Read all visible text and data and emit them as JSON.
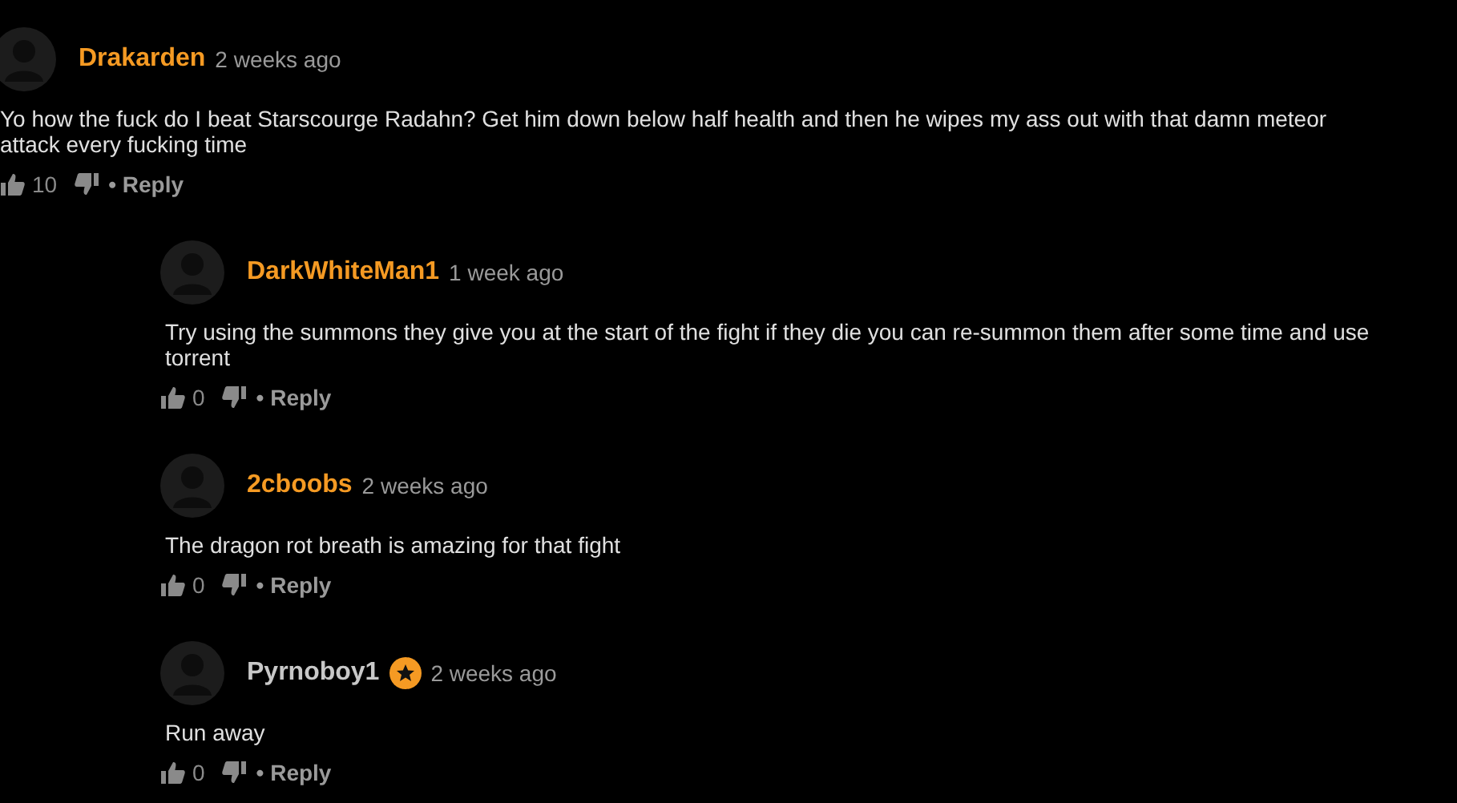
{
  "comment": {
    "author": "Drakarden",
    "color": "#f59a23",
    "badge": false,
    "time": "2 weeks ago",
    "text": "Yo how the fuck do I beat Starscourge Radahn? Get him down below half health and then he wipes my ass out with that damn meteor attack every fucking time",
    "likes": "10",
    "reply": "• Reply",
    "children": [
      {
        "author": "DarkWhiteMan1",
        "color": "#f59a23",
        "badge": false,
        "time": "1 week ago",
        "text": "Try using the summons they give you at the start of the fight if they die you can re-summon them after some time and use torrent",
        "likes": "0",
        "reply": "• Reply"
      },
      {
        "author": "2cboobs",
        "color": "#f59a23",
        "badge": false,
        "time": "2 weeks ago",
        "text": "The dragon rot breath is amazing for that fight",
        "likes": "0",
        "reply": "• Reply"
      },
      {
        "author": "Pyrnoboy1",
        "color": "#c8c8c8",
        "badge": true,
        "time": "2 weeks ago",
        "text": "Run away",
        "likes": "0",
        "reply": "• Reply"
      }
    ]
  }
}
